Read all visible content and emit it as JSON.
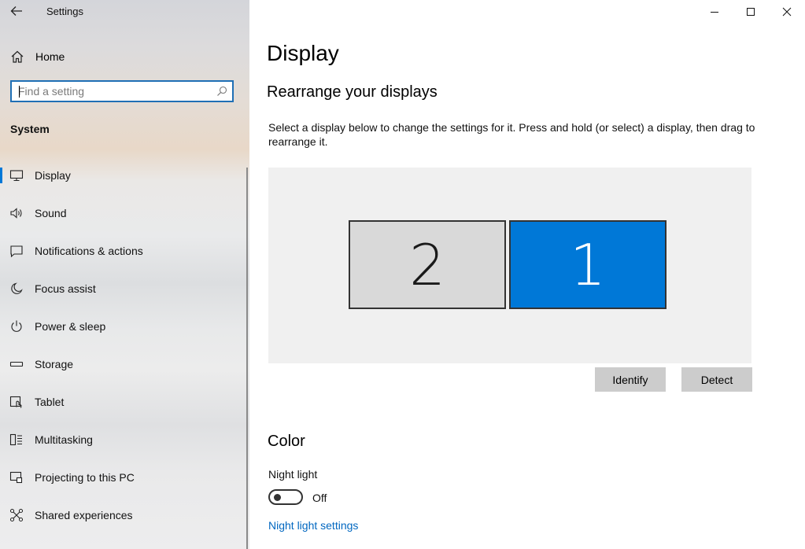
{
  "app": {
    "title": "Settings"
  },
  "sidebar": {
    "home_label": "Home",
    "search": {
      "placeholder": "Find a setting",
      "value": ""
    },
    "section_title": "System",
    "items": [
      {
        "label": "Display",
        "icon": "display-icon",
        "selected": true
      },
      {
        "label": "Sound",
        "icon": "speaker-icon"
      },
      {
        "label": "Notifications & actions",
        "icon": "notification-icon"
      },
      {
        "label": "Focus assist",
        "icon": "moon-icon"
      },
      {
        "label": "Power & sleep",
        "icon": "power-icon"
      },
      {
        "label": "Storage",
        "icon": "storage-icon"
      },
      {
        "label": "Tablet",
        "icon": "tablet-icon"
      },
      {
        "label": "Multitasking",
        "icon": "multitasking-icon"
      },
      {
        "label": "Projecting to this PC",
        "icon": "projecting-icon"
      },
      {
        "label": "Shared experiences",
        "icon": "shared-experiences-icon"
      }
    ]
  },
  "main": {
    "title": "Display",
    "arrange": {
      "heading": "Rearrange your displays",
      "description": "Select a display below to change the settings for it. Press and hold (or select) a display, then drag to rearrange it.",
      "monitors": [
        {
          "number": "2",
          "selected": false
        },
        {
          "number": "1",
          "selected": true
        }
      ],
      "identify_label": "Identify",
      "detect_label": "Detect"
    },
    "color": {
      "heading": "Color",
      "night_light_label": "Night light",
      "night_light_state": "Off",
      "night_light_on": false,
      "night_light_link": "Night light settings"
    }
  },
  "colors": {
    "accent": "#0078d7",
    "link": "#0067c0",
    "button_bg": "#cccccc",
    "arrange_bg": "#f0f0f0"
  }
}
